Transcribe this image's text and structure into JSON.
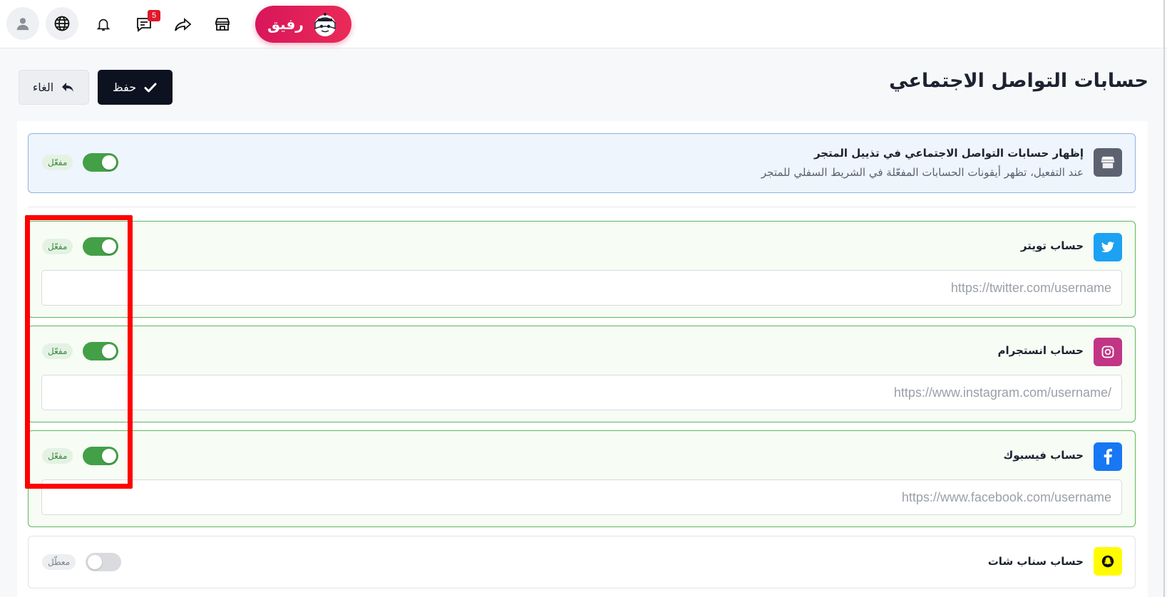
{
  "topbar": {
    "notification_count": "5",
    "brand_label": "رفيق",
    "icons": [
      "user-icon",
      "globe-icon",
      "bell-icon",
      "messages-icon",
      "share-icon",
      "store-icon"
    ]
  },
  "header": {
    "title": "حسابات التواصل الاجتماعي",
    "save_label": "حفظ",
    "cancel_label": "الغاء"
  },
  "footer_setting": {
    "title": "إظهار حسابات التواصل الاجتماعي في تذييل المتجر",
    "description": "عند التفعيل، تظهر أيقونات الحسابات المفعّلة في الشريط السفلي للمتجر",
    "status": "مفعّل",
    "enabled": true
  },
  "accounts": {
    "twitter": {
      "label": "حساب تويتر",
      "placeholder": "https://twitter.com/username",
      "value": "",
      "status": "مفعّل",
      "enabled": true,
      "color": "#1da1f2"
    },
    "instagram": {
      "label": "حساب انستجرام",
      "placeholder": "https://www.instagram.com/username/",
      "value": "",
      "status": "مفعّل",
      "enabled": true,
      "color": "#c13584"
    },
    "facebook": {
      "label": "حساب فيسبوك",
      "placeholder": "https://www.facebook.com/username",
      "value": "",
      "status": "مفعّل",
      "enabled": true,
      "color": "#1877f2"
    },
    "snapchat": {
      "label": "حساب سناب شات",
      "status": "معطّل",
      "enabled": false,
      "color": "#fffc00"
    }
  },
  "colors": {
    "accent_green": "#43a047",
    "brand_pink": "#e01f5c",
    "highlight_red": "#ff0000",
    "dark_button": "#0c1220"
  }
}
